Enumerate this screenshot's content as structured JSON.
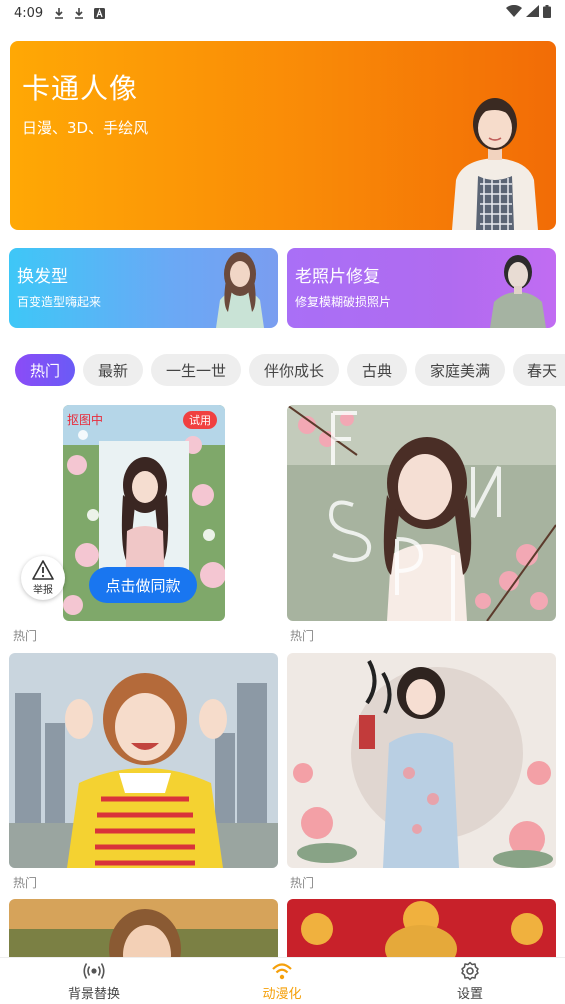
{
  "status_bar": {
    "time": "4:09",
    "icons": [
      "download-icon",
      "download-icon",
      "a-icon"
    ],
    "right_icons": [
      "wifi-icon",
      "signal-icon",
      "battery-icon"
    ]
  },
  "banner": {
    "title": "卡通人像",
    "subtitle": "日漫、3D、手绘风"
  },
  "features": [
    {
      "title": "换发型",
      "subtitle": "百变造型嗨起来"
    },
    {
      "title": "老照片修复",
      "subtitle": "修复模糊破损照片"
    }
  ],
  "tags": [
    "热门",
    "最新",
    "一生一世",
    "伴你成长",
    "古典",
    "家庭美满",
    "春天"
  ],
  "active_tag": "热门",
  "grid": {
    "items": [
      {
        "label": "热门",
        "badge_left": "抠图中",
        "badge_right": "试用",
        "cta": "点击做同款"
      },
      {
        "label": "热门"
      },
      {
        "label": "热门"
      },
      {
        "label": "热门"
      }
    ]
  },
  "report": {
    "label": "举报"
  },
  "bottom_nav": [
    {
      "label": "背景替换",
      "icon": "radio-waves-icon"
    },
    {
      "label": "动漫化",
      "icon": "wifi-icon"
    },
    {
      "label": "设置",
      "icon": "gear-icon"
    }
  ],
  "colors": {
    "accent": "#f5a00a",
    "banner": "#f98a07",
    "cta": "#1976f0",
    "active_tag": "#7a52f6"
  }
}
